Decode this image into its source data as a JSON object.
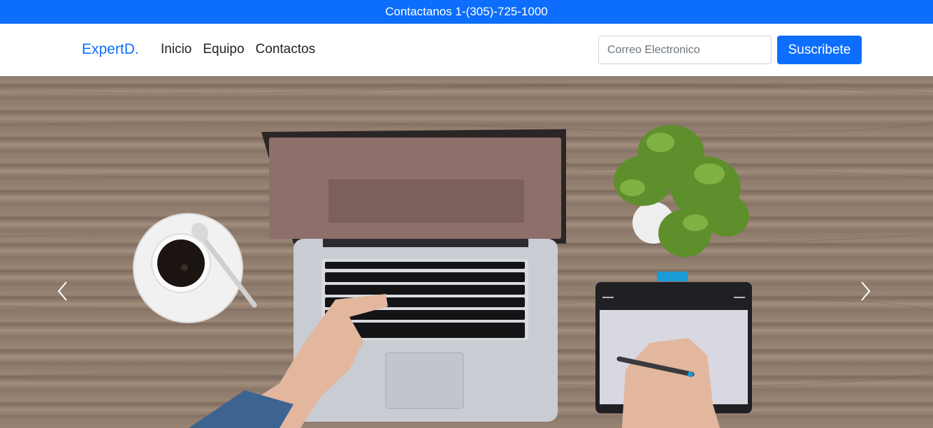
{
  "topbar": {
    "contact_text": "Contactanos 1-(305)-725-1000"
  },
  "navbar": {
    "brand": "ExpertD.",
    "links": [
      {
        "label": "Inicio"
      },
      {
        "label": "Equipo"
      },
      {
        "label": "Contactos"
      }
    ],
    "email_placeholder": "Correo Electronico",
    "subscribe_label": "Suscribete"
  },
  "carousel": {
    "prev_icon": "chevron-left-icon",
    "next_icon": "chevron-right-icon"
  },
  "colors": {
    "primary": "#0d6efd",
    "text": "#222222"
  }
}
